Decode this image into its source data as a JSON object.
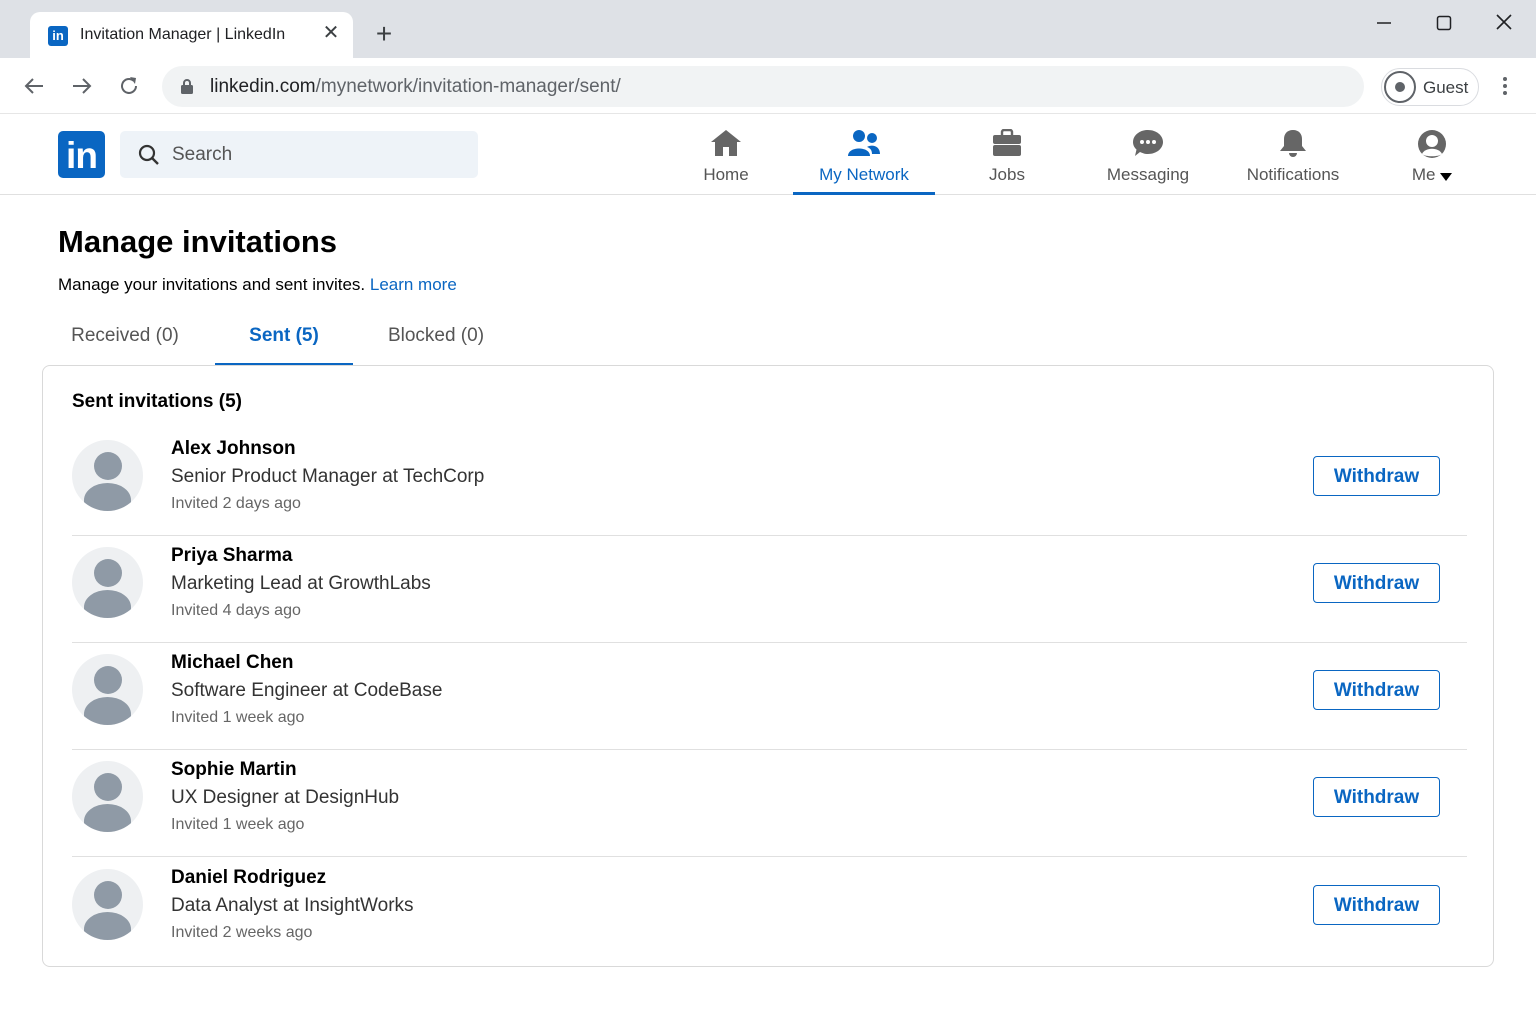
{
  "browser": {
    "tab_title": "Invitation Manager | LinkedIn",
    "favicon_text": "in",
    "url_host": "linkedin.com",
    "url_path": "/mynetwork/invitation-manager/sent/",
    "profile_label": "Guest"
  },
  "header": {
    "logo_text": "in",
    "search_placeholder": "Search",
    "nav": [
      {
        "label": "Home",
        "icon": "home-icon",
        "active": false
      },
      {
        "label": "My Network",
        "icon": "my-network-icon",
        "active": true
      },
      {
        "label": "Jobs",
        "icon": "jobs-icon",
        "active": false
      },
      {
        "label": "Messaging",
        "icon": "messaging-icon",
        "active": false
      },
      {
        "label": "Notifications",
        "icon": "notifications-icon",
        "active": false
      },
      {
        "label": "Me",
        "icon": "me-icon",
        "active": false
      }
    ]
  },
  "page": {
    "title": "Manage invitations",
    "subtitle": "Manage your invitations and sent invites.",
    "learn_more": "Learn more",
    "tabs": [
      {
        "label": "Received (0)",
        "active": false
      },
      {
        "label": "Sent (5)",
        "active": true
      },
      {
        "label": "Blocked (0)",
        "active": false
      }
    ]
  },
  "sent": {
    "title": "Sent invitations (5)",
    "withdraw_label": "Withdraw",
    "items": [
      {
        "name": "Alex Johnson",
        "headline": "Senior Product Manager at TechCorp",
        "time": "Invited 2 days ago"
      },
      {
        "name": "Priya Sharma",
        "headline": "Marketing Lead at GrowthLabs",
        "time": "Invited 4 days ago"
      },
      {
        "name": "Michael Chen",
        "headline": "Software Engineer at CodeBase",
        "time": "Invited 1 week ago"
      },
      {
        "name": "Sophie Martin",
        "headline": "UX Designer at DesignHub",
        "time": "Invited 1 week ago"
      },
      {
        "name": "Daniel Rodriguez",
        "headline": "Data Analyst at InsightWorks",
        "time": "Invited 2 weeks ago"
      }
    ]
  },
  "colors": {
    "brand": "#0a66c2",
    "chrome_bg": "#dee1e6"
  }
}
